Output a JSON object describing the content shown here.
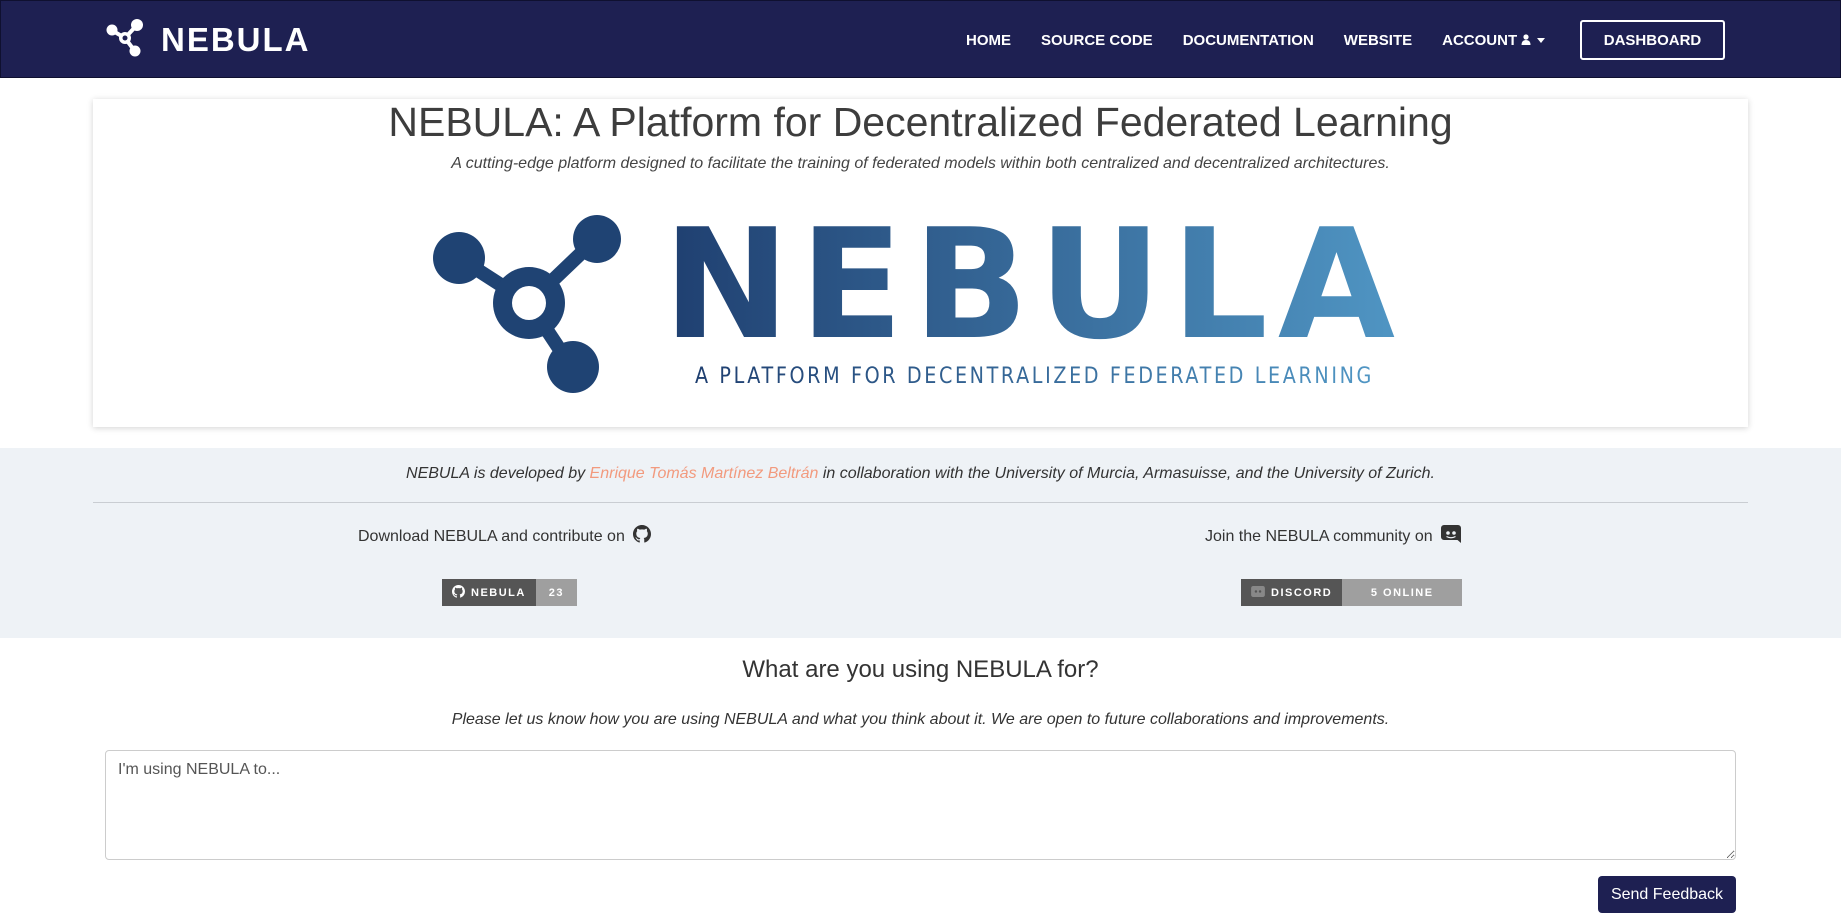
{
  "navbar": {
    "brand": "NEBULA",
    "links": [
      "HOME",
      "SOURCE CODE",
      "DOCUMENTATION",
      "WEBSITE"
    ],
    "account": "ACCOUNT",
    "dashboard": "DASHBOARD"
  },
  "hero": {
    "title": "NEBULA: A Platform for Decentralized Federated Learning",
    "subtitle": "A cutting-edge platform designed to facilitate the training of federated models within both centralized and decentralized architectures.",
    "logo_word": "NEBULA",
    "logo_tagline": "A PLATFORM FOR DECENTRALIZED FEDERATED LEARNING"
  },
  "credits": {
    "prefix": "NEBULA is developed by",
    "author": "Enrique Tomás Martínez Beltrán",
    "suffix": "in collaboration with the University of Murcia, Armasuisse, and the University of Zurich."
  },
  "community": {
    "github_text": "Download NEBULA and contribute on",
    "github_badge_label": "NEBULA",
    "github_badge_value": "23",
    "discord_text": "Join the NEBULA community on",
    "discord_badge_label": "DISCORD",
    "discord_badge_value": "5 ONLINE"
  },
  "feedback": {
    "title": "What are you using NEBULA for?",
    "description": "Please let us know how you are using NEBULA and what you think about it. We are open to future collaborations and improvements.",
    "placeholder": "I'm using NEBULA to...",
    "button": "Send Feedback"
  },
  "colors": {
    "navbar": "#1e2052",
    "logo_dark": "#1f3f70",
    "logo_light": "#5096c4",
    "author_link": "#f29a7e"
  },
  "icons": [
    "share-nodes-icon",
    "user-icon",
    "github-icon",
    "discord-icon"
  ]
}
